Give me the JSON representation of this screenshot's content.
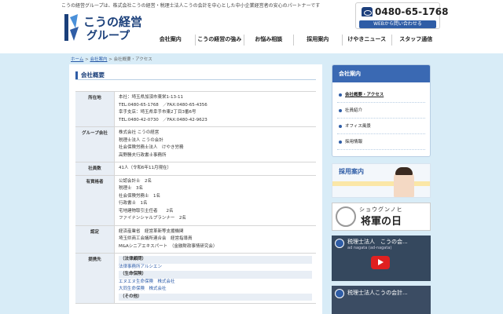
{
  "header": {
    "tagline": "こうの経営グループは、株式会社こうの経営・税理士法人こうの会計を中心とした中小企業経営者の安心のパートナーです",
    "logo_line1": "こうの経営",
    "logo_line2": "グループ",
    "phone": "0480-65-1768",
    "web_button": "WEBから問い合わせる"
  },
  "nav": {
    "items": [
      "会社案内",
      "こうの経営の強み",
      "お悩み相談",
      "採用案内",
      "けやきニュース",
      "スタッフ通信"
    ]
  },
  "breadcrumb": {
    "home": "ホーム",
    "sep": " > ",
    "parent": "会社案内",
    "current": "会社概要・アクセス"
  },
  "main": {
    "title": "会社概要",
    "rows": [
      {
        "label": "所在地",
        "lines": [
          "本社：埼玉県加須市東栄1-13-11",
          "TEL:0480-65-1768　／FAX:0480-65-4356",
          "幸手支店：埼玉県幸手市東2丁目3番6号",
          "TEL:0480-42-0730　／FAX:0480-42-9623"
        ]
      },
      {
        "label": "グループ会社",
        "lines": [
          "株式会社 こうの経営",
          "税理士法人 こうの会計",
          "社会保険労務士法人　けやき労務",
          "高野勝夫行政書士事務所"
        ]
      },
      {
        "label": "社員数",
        "lines": [
          "41人（令和6年11月現在）"
        ]
      },
      {
        "label": "有資格者",
        "lines": [
          "公認会計士　2名",
          "税理士　3名",
          "社会保険労務士　1名",
          "行政書士　1名",
          "宅地建物取引主任者　　2名",
          "ファイナンシャルプランナー　2名"
        ]
      },
      {
        "label": "認定",
        "lines": [
          "経済産業省　経営革新等支援機関",
          "埼玉県商工会議所連合会　経営指導員",
          "M&Aシニアエキスパート　（金融財政事情研究会）"
        ]
      }
    ],
    "partners_label": "提携先",
    "partners": [
      {
        "type": "head",
        "text": "（法律顧問）"
      },
      {
        "type": "link",
        "text": "法律事務所アルシエン"
      },
      {
        "type": "head",
        "text": "（生命保険）"
      },
      {
        "type": "link",
        "text": "エヌエヌ生命保険　株式会社"
      },
      {
        "type": "link",
        "text": "大同生命保険　株式会社"
      },
      {
        "type": "head",
        "text": "（その他）"
      }
    ]
  },
  "sidebar": {
    "heading": "会社案内",
    "items": [
      "会社概要・アクセス",
      "社員紹介",
      "オフィス風景",
      "採用情報"
    ]
  },
  "banners": {
    "recruit": "採用案内",
    "small_text": "ショウグンノヒ",
    "big_text": "将軍の日"
  },
  "videos": {
    "v1_title": "税理士法人　こうの会...",
    "v1_channel": "ad nagata (ad-nagata)",
    "v2_title": "税理士法人こうの会計..."
  },
  "colors": {
    "brand": "#1a3f7a",
    "accent": "#3a69b3",
    "band": "#d8ecf7"
  }
}
